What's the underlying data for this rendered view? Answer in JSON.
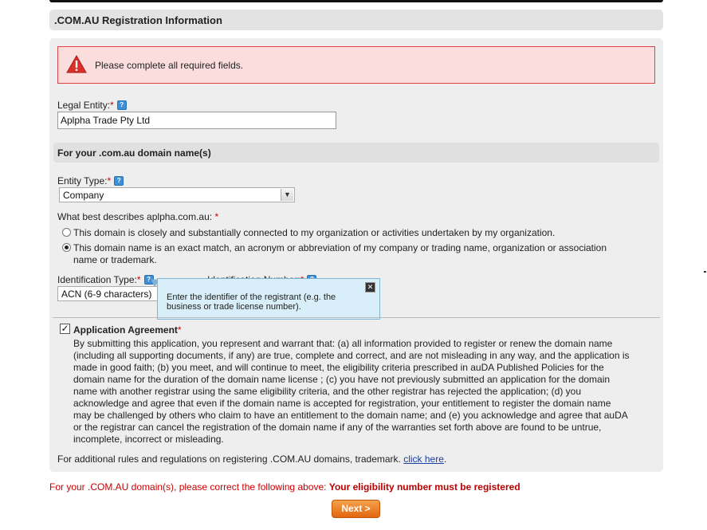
{
  "section": {
    "title": ".COM.AU Registration Information"
  },
  "alert": {
    "message": "Please complete all required fields."
  },
  "legal_entity": {
    "label": "Legal Entity:",
    "required_mark": "*",
    "help_icon": "?",
    "value": "Aplpha Trade Pty Ltd"
  },
  "domain_section": {
    "title": "For your .com.au domain name(s)"
  },
  "entity_type": {
    "label": "Entity Type:",
    "required_mark": "*",
    "help_icon": "?",
    "selected": "Company"
  },
  "describes": {
    "label": "What best describes aplpha.com.au:",
    "required_mark": "*",
    "options": [
      {
        "text": "This domain is closely and substantially connected to my organization or activities undertaken by my organization.",
        "checked": false
      },
      {
        "text_line1": "This domain name is an exact match, an acronym or abbreviation of my company or trading name, organization or association",
        "text_line2": "name or trademark.",
        "checked": true
      }
    ]
  },
  "identification_type": {
    "label": "Identification Type:",
    "required_mark": "*",
    "help_icon": "?",
    "selected": "ACN (6-9 characters)"
  },
  "identification_number": {
    "label": "Identification Number:",
    "required_mark": "*",
    "help_icon": "?"
  },
  "tooltip": {
    "text": "Enter the identifier of the registrant (e.g. the business or trade license number).",
    "close_glyph": "✕"
  },
  "agreement": {
    "checked": true,
    "title": "Application Agreement",
    "required_mark": "*",
    "body": "By submitting this application, you represent and warrant that: (a) all information provided to register or renew the domain name (including all supporting documents, if any) are true, complete and correct, and are not misleading in any way, and the application is made in good faith; (b) you meet, and will continue to meet, the eligibility criteria prescribed in auDA Published Policies for the domain name for the duration of the domain name license ; (c) you have not previously submitted an application for the domain name with another registrar using the same eligibility criteria, and the other registrar has rejected the application; (d) you acknowledge and agree that even if the domain name is accepted for registration, your entitlement to register the domain name may be challenged by others who claim to have an entitlement to the domain name; and (e) you acknowledge and agree that auDA or the registrar can cancel the registration of the domain name if any of the warranties set forth above are found to be untrue, incomplete, incorrect or misleading.",
    "rules_text": "For additional rules and regulations on registering .COM.AU domains, trademark.",
    "rules_link": "click here",
    "rules_end": "."
  },
  "error": {
    "prefix": "For your .COM.AU domain(s), please correct the following above:",
    "message": "Your eligibility number must be registered"
  },
  "next_button": {
    "label": "Next >"
  },
  "colors": {
    "alert_bg": "#fcdddd",
    "alert_border": "#dd4444",
    "error_red": "#cc0000",
    "button_orange": "#e8781c",
    "tooltip_bg": "#d8eef8"
  }
}
